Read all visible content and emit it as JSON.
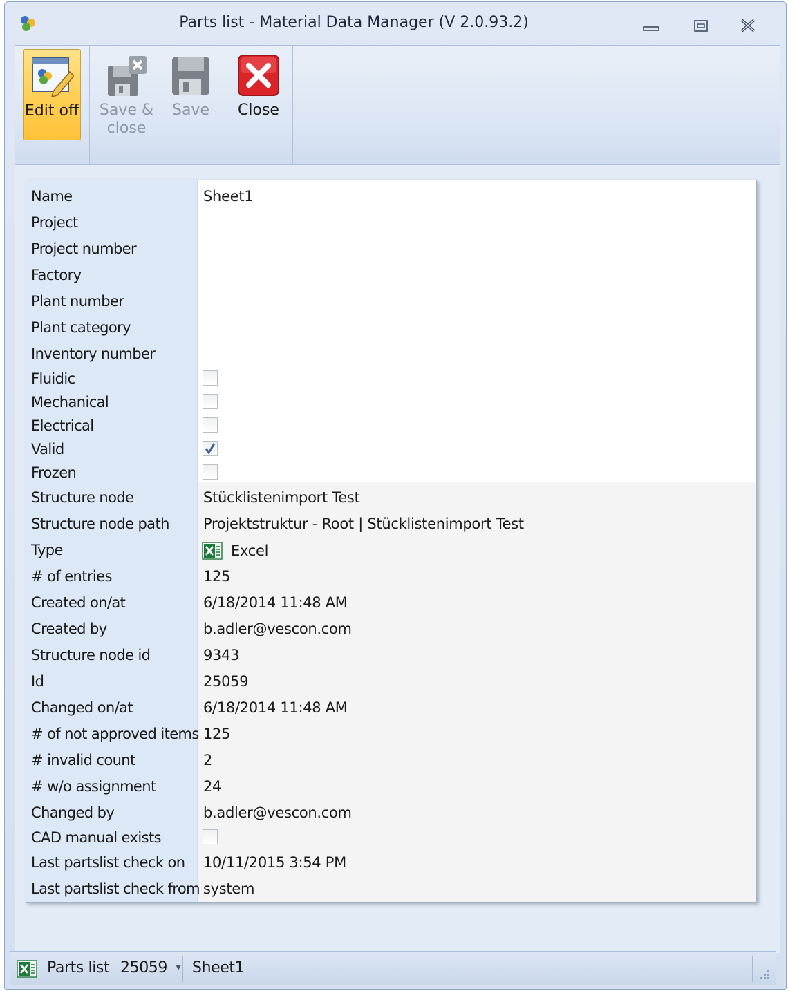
{
  "window": {
    "title": "Parts list - Material Data Manager (V 2.0.93.2)"
  },
  "ribbon": {
    "buttons": [
      {
        "label": "Edit off",
        "icon": "edit-icon",
        "state": "active"
      },
      {
        "label_line1": "Save &",
        "label_line2": "close",
        "icon": "save-close-icon",
        "state": "disabled"
      },
      {
        "label": "Save",
        "icon": "save-icon",
        "state": "disabled"
      },
      {
        "label": "Close",
        "icon": "close-red-icon",
        "state": "enabled"
      }
    ]
  },
  "properties": [
    {
      "label": "Name",
      "value": "Sheet1"
    },
    {
      "label": "Project",
      "value": ""
    },
    {
      "label": "Project number",
      "value": ""
    },
    {
      "label": "Factory",
      "value": ""
    },
    {
      "label": "Plant number",
      "value": ""
    },
    {
      "label": "Plant category",
      "value": ""
    },
    {
      "label": "Inventory number",
      "value": ""
    },
    {
      "label": "Fluidic",
      "checked": false
    },
    {
      "label": "Mechanical",
      "checked": false
    },
    {
      "label": "Electrical",
      "checked": false
    },
    {
      "label": "Valid",
      "checked": true
    },
    {
      "label": "Frozen",
      "checked": false
    },
    {
      "label": "Structure node",
      "value": "Stücklistenimport Test"
    },
    {
      "label": "Structure node path",
      "value": "Projektstruktur - Root | Stücklistenimport Test"
    },
    {
      "label": "Type",
      "value": "Excel",
      "icon": "excel-icon"
    },
    {
      "label": "# of entries",
      "value": "125"
    },
    {
      "label": "Created on/at",
      "value": "6/18/2014 11:48 AM"
    },
    {
      "label": "Created by",
      "value": "b.adler@vescon.com"
    },
    {
      "label": "Structure node id",
      "value": "9343"
    },
    {
      "label": "Id",
      "value": "25059"
    },
    {
      "label": "Changed on/at",
      "value": "6/18/2014 11:48 AM"
    },
    {
      "label": "# of not approved items",
      "value": "125"
    },
    {
      "label": "# invalid count",
      "value": "2"
    },
    {
      "label": "# w/o assignment",
      "value": "24"
    },
    {
      "label": "Changed by",
      "value": "b.adler@vescon.com"
    },
    {
      "label": "CAD manual exists",
      "checked": false
    },
    {
      "label": "Last partslist check on",
      "value": "10/11/2015 3:54 PM"
    },
    {
      "label": "Last partslist check from",
      "value": "system"
    }
  ],
  "statusbar": {
    "module": "Parts list",
    "id": "25059",
    "dropdown_glyph": "▾",
    "sheet": "Sheet1"
  },
  "colors": {
    "active_button": "#ffd056",
    "close_red": "#d9252a",
    "excel_green": "#1e7a3c",
    "label_column": "#dde8f6"
  }
}
